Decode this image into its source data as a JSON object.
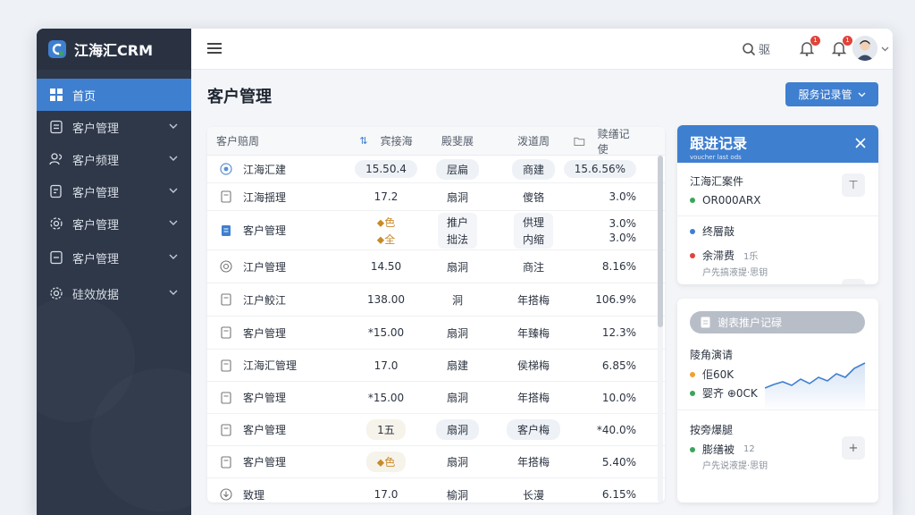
{
  "brand": {
    "name": "江海汇CRM"
  },
  "colors": {
    "accent": "#3f7fd0",
    "sidebar": "#2e3848",
    "red": "#e0443a",
    "green": "#3aa55a",
    "blue": "#3f7fd0",
    "orange": "#f0a030"
  },
  "sidebar": {
    "items": [
      {
        "label": "首页",
        "icon": "grid-icon",
        "active": true
      },
      {
        "label": "客户管理",
        "icon": "document-icon"
      },
      {
        "label": "客户频理",
        "icon": "users-icon"
      },
      {
        "label": "客户管理",
        "icon": "edit-doc-icon"
      },
      {
        "label": "客户管理",
        "icon": "settings-icon"
      },
      {
        "label": "客户管理",
        "icon": "note-icon"
      },
      {
        "label": "硅效放据",
        "icon": "gear-icon"
      }
    ]
  },
  "topbar": {
    "search_label": "驱",
    "bell1_badge": "1",
    "bell2_badge": "1"
  },
  "page": {
    "title": "客户管理",
    "primary_button": "服务记录管"
  },
  "table": {
    "headers": [
      "客户赔周",
      "宾接海",
      "殿斐展",
      "泼道周",
      "赎缮记使"
    ],
    "rows": [
      {
        "name": "江海汇建",
        "icon": "chat-icon",
        "v1": "15.50.4",
        "v2": "层扁",
        "v3": "商建",
        "v4": "15.6.56%",
        "pill": true
      },
      {
        "name": "江海揺理",
        "icon": "doc-icon",
        "v1": "17.2",
        "v2": "扇洞",
        "v3": "傻铬",
        "v4": "3.0%"
      },
      {
        "name": "客户管理",
        "icon": "blue-doc-icon",
        "v1a": "⬥色",
        "v1b": "⬥全",
        "v2a": "推户",
        "v2b": "拙法",
        "v3a": "供理",
        "v3b": "内缩",
        "v4a": "3.0%",
        "v4b": "3.0%",
        "double": true
      },
      {
        "name": "江户管理",
        "icon": "target-icon",
        "v1": "14.50",
        "v2": "扇洞",
        "v3": "商注",
        "v4": "8.16%"
      },
      {
        "name": "江户鲛江",
        "icon": "doc-icon",
        "v1": "138.00",
        "v2": "洞",
        "v3": "年搭梅",
        "v4": "106.9%"
      },
      {
        "name": "客户管理",
        "icon": "doc-icon",
        "v1": "*15.00",
        "v2": "扇洞",
        "v3": "年臻梅",
        "v4": "12.3%"
      },
      {
        "name": "江海汇管理",
        "icon": "doc-icon",
        "v1": "17.0",
        "v2": "扇建",
        "v3": "侯梯梅",
        "v4": "6.85%"
      },
      {
        "name": "客户管理",
        "icon": "doc-icon",
        "v1": "*15.00",
        "v2": "扇洞",
        "v3": "年搭梅",
        "v4": "10.0%"
      },
      {
        "name": "客户管理",
        "icon": "doc-icon",
        "v1": "1五",
        "v2": "扇洞",
        "v3": "客户梅",
        "v4": "*40.0%",
        "pill": true
      },
      {
        "name": "客户管理",
        "icon": "doc-icon",
        "v1": "⬥色",
        "v2": "扇洞",
        "v3": "年搭梅",
        "v4": "5.40%",
        "pill": true
      },
      {
        "name": "致理",
        "icon": "download-icon",
        "v1": "17.0",
        "v2": "榆洞",
        "v3": "长漫",
        "v4": "6.15%"
      }
    ]
  },
  "follow": {
    "title": "跟进记录",
    "subtitle": "voucher last ods",
    "item1": "江海汇案件",
    "item1_value": "OR000ARX",
    "item2": "终層敲",
    "item3": "余滞费",
    "item3_sub": "1乐",
    "item3_desc": "户先搞液提·思钥"
  },
  "stats": {
    "pill_label": "谢表推户记碌",
    "section1": "陵角演请",
    "line1": "佢60K",
    "line2": "婴齐 ⊕0CK",
    "section2": "按旁爆腿",
    "line3": "膨缮被",
    "line3_sub": "12",
    "line3_desc": "户先说液提·思钥"
  }
}
